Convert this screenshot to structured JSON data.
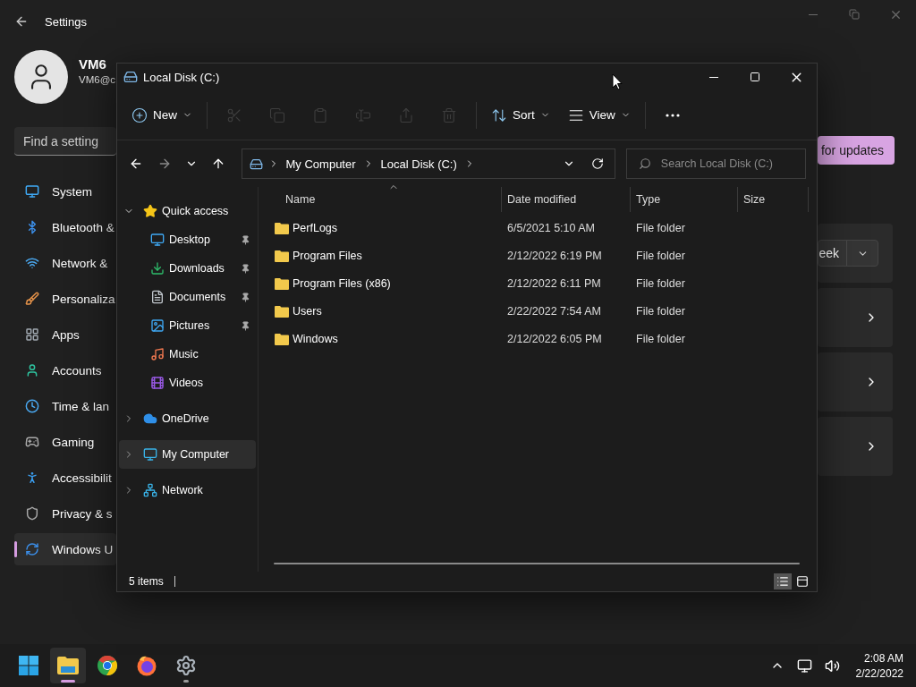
{
  "settings": {
    "title": "Settings",
    "user": {
      "name": "VM6",
      "email": "VM6@c"
    },
    "search": {
      "placeholder": "Find a setting"
    },
    "nav": [
      {
        "kind": "system",
        "label": "System",
        "selected": false
      },
      {
        "kind": "bluetooth",
        "label": "Bluetooth &",
        "selected": false
      },
      {
        "kind": "network",
        "label": "Network &",
        "selected": false
      },
      {
        "kind": "personalization",
        "label": "Personaliza",
        "selected": false
      },
      {
        "kind": "apps",
        "label": "Apps",
        "selected": false
      },
      {
        "kind": "accounts",
        "label": "Accounts",
        "selected": false
      },
      {
        "kind": "time",
        "label": "Time & lan",
        "selected": false
      },
      {
        "kind": "gaming",
        "label": "Gaming",
        "selected": false
      },
      {
        "kind": "accessibility",
        "label": "Accessibilit",
        "selected": false
      },
      {
        "kind": "privacy",
        "label": "Privacy & s",
        "selected": false
      },
      {
        "kind": "update",
        "label": "Windows U",
        "selected": true
      }
    ],
    "check_button": "for updates",
    "cards": [
      {
        "kind": "dropdown",
        "value": "eek"
      },
      {
        "kind": "link"
      },
      {
        "kind": "link"
      },
      {
        "kind": "link"
      }
    ]
  },
  "explorer": {
    "title": "Local Disk (C:)",
    "toolbar": [
      {
        "kind": "new",
        "label": "New",
        "disabled": false
      },
      {
        "kind": "separator"
      },
      {
        "kind": "cut",
        "disabled": true
      },
      {
        "kind": "copy",
        "disabled": true
      },
      {
        "kind": "paste",
        "disabled": true
      },
      {
        "kind": "rename",
        "disabled": true
      },
      {
        "kind": "share",
        "disabled": true
      },
      {
        "kind": "delete",
        "disabled": true
      },
      {
        "kind": "separator"
      },
      {
        "kind": "sort",
        "label": "Sort",
        "disabled": false
      },
      {
        "kind": "view",
        "label": "View",
        "disabled": false
      },
      {
        "kind": "separator"
      },
      {
        "kind": "more",
        "disabled": false
      }
    ],
    "address": {
      "path": [
        "My Computer",
        "Local Disk (C:)"
      ]
    },
    "search": {
      "placeholder": "Search Local Disk (C:)"
    },
    "tree": [
      {
        "kind": "quick-access",
        "label": "Quick access",
        "expanded": true,
        "selected": false,
        "children": [
          {
            "kind": "desktop",
            "label": "Desktop",
            "pinned": true,
            "selected": false
          },
          {
            "kind": "downloads",
            "label": "Downloads",
            "pinned": true,
            "selected": false
          },
          {
            "kind": "documents",
            "label": "Documents",
            "pinned": true,
            "selected": false
          },
          {
            "kind": "pictures",
            "label": "Pictures",
            "pinned": true,
            "selected": false
          },
          {
            "kind": "music",
            "label": "Music",
            "pinned": false,
            "selected": false
          },
          {
            "kind": "videos",
            "label": "Videos",
            "pinned": false,
            "selected": false
          }
        ]
      },
      {
        "kind": "onedrive",
        "label": "OneDrive",
        "expanded": false,
        "selected": false
      },
      {
        "kind": "computer",
        "label": "My Computer",
        "expanded": false,
        "selected": true
      },
      {
        "kind": "network",
        "label": "Network",
        "expanded": false,
        "selected": false
      }
    ],
    "columns": [
      {
        "label": "Name",
        "sorted": true
      },
      {
        "label": "Date modified",
        "sorted": false
      },
      {
        "label": "Type",
        "sorted": false
      },
      {
        "label": "Size",
        "sorted": false
      }
    ],
    "rows": [
      {
        "name": "PerfLogs",
        "date": "6/5/2021 5:10 AM",
        "type": "File folder"
      },
      {
        "name": "Program Files",
        "date": "2/12/2022 6:19 PM",
        "type": "File folder"
      },
      {
        "name": "Program Files (x86)",
        "date": "2/12/2022 6:11 PM",
        "type": "File folder"
      },
      {
        "name": "Users",
        "date": "2/22/2022 7:54 AM",
        "type": "File folder"
      },
      {
        "name": "Windows",
        "date": "2/12/2022 6:05 PM",
        "type": "File folder"
      }
    ],
    "status": "5 items",
    "view_modes": [
      {
        "kind": "details",
        "selected": true
      },
      {
        "kind": "tiles",
        "selected": false
      }
    ]
  },
  "taskbar": {
    "apps": [
      {
        "kind": "start",
        "active": false,
        "running": false
      },
      {
        "kind": "explorer",
        "active": true,
        "running": true
      },
      {
        "kind": "chrome",
        "active": false,
        "running": false
      },
      {
        "kind": "firefox",
        "active": false,
        "running": false
      },
      {
        "kind": "settings",
        "active": false,
        "running": true
      }
    ],
    "clock": {
      "time": "2:08 AM",
      "date": "2/22/2022"
    }
  }
}
